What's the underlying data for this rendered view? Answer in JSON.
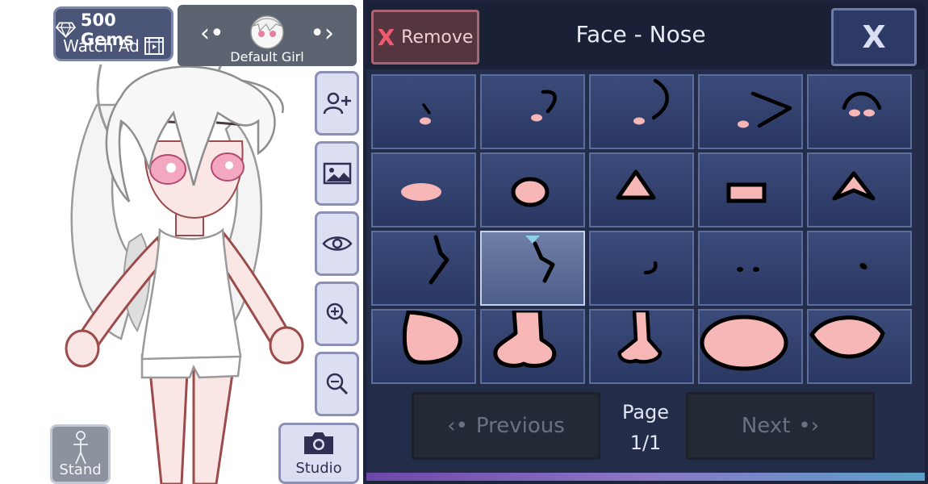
{
  "currency": {
    "gems": "500 Gems",
    "watch_ad": "Watch Ad"
  },
  "character": {
    "name": "Default Girl"
  },
  "tools": [
    "add-character",
    "background",
    "eye-toggle",
    "zoom-in",
    "zoom-out"
  ],
  "buttons": {
    "stand": "Stand",
    "studio": "Studio"
  },
  "panel": {
    "title": "Face - Nose",
    "remove_label": "Remove",
    "close_label": "X",
    "pager": {
      "previous_label": "Previous",
      "next_label": "Next",
      "page_label": "Page",
      "page_value": "1/1"
    },
    "selected_index": 6,
    "options": [
      "dot-nose",
      "hook-nose",
      "curve-nose",
      "angle-nose",
      "arc-nose",
      "blush-oval",
      "circle-nose",
      "triangle-nose",
      "rectangle-nose",
      "notched-triangle",
      "zigzag-nose",
      "bent-nose",
      "tick-nose",
      "two-dots",
      "single-dot",
      "round-big-nose",
      "realistic-nose",
      "tall-nose",
      "wide-oval",
      "semi-circle"
    ]
  },
  "colors": {
    "panel_bg": "#232d4a",
    "cell_bg": "#35457a",
    "skin": "#f7c0c2",
    "accent_red": "#ef5a6e"
  }
}
